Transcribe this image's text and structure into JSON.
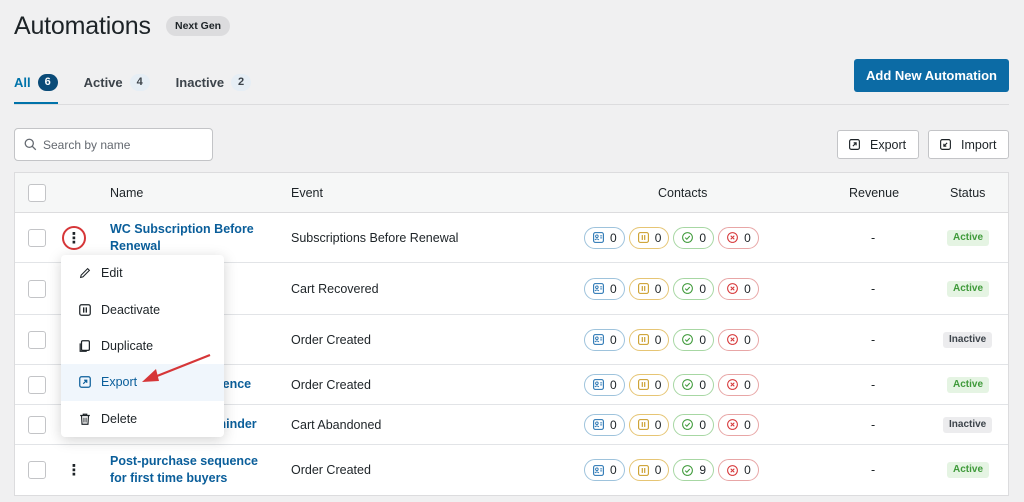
{
  "page": {
    "title": "Automations",
    "badge": "Next Gen"
  },
  "tabs": [
    {
      "label": "All",
      "count": "6"
    },
    {
      "label": "Active",
      "count": "4"
    },
    {
      "label": "Inactive",
      "count": "2"
    }
  ],
  "add_button": "Add New Automation",
  "search": {
    "placeholder": "Search by name"
  },
  "toolbar": {
    "export": "Export",
    "import": "Import"
  },
  "table": {
    "headers": {
      "name": "Name",
      "event": "Event",
      "contacts": "Contacts",
      "revenue": "Revenue",
      "status": "Status"
    },
    "rows": [
      {
        "name": "WC Subscription Before Renewal",
        "event": "Subscriptions Before Renewal",
        "contacts": [
          "0",
          "0",
          "0",
          "0"
        ],
        "revenue": "-",
        "status": "Active"
      },
      {
        "name": "",
        "event": "Cart Recovered",
        "contacts": [
          "0",
          "0",
          "0",
          "0"
        ],
        "revenue": "-",
        "status": "Active"
      },
      {
        "name": "",
        "event": "Order Created",
        "contacts": [
          "0",
          "0",
          "0",
          "0"
        ],
        "revenue": "-",
        "status": "Inactive"
      },
      {
        "name": "uence",
        "event": "Order Created",
        "contacts": [
          "0",
          "0",
          "0",
          "0"
        ],
        "revenue": "-",
        "status": "Active"
      },
      {
        "name": "minder",
        "event": "Cart Abandoned",
        "contacts": [
          "0",
          "0",
          "0",
          "0"
        ],
        "revenue": "-",
        "status": "Inactive"
      },
      {
        "name": "Post-purchase sequence for first time buyers",
        "event": "Order Created",
        "contacts": [
          "0",
          "0",
          "9",
          "0"
        ],
        "revenue": "-",
        "status": "Active"
      }
    ]
  },
  "menu": {
    "items": [
      {
        "label": "Edit",
        "icon": "pencil-icon"
      },
      {
        "label": "Deactivate",
        "icon": "pause-icon"
      },
      {
        "label": "Duplicate",
        "icon": "copy-icon"
      },
      {
        "label": "Export",
        "icon": "export-icon"
      },
      {
        "label": "Delete",
        "icon": "trash-icon"
      }
    ]
  },
  "colors": {
    "accent": "#0c6ba5",
    "link": "#0a5e9a",
    "active_status": "#3f9a3a",
    "annotation": "#d63638"
  }
}
